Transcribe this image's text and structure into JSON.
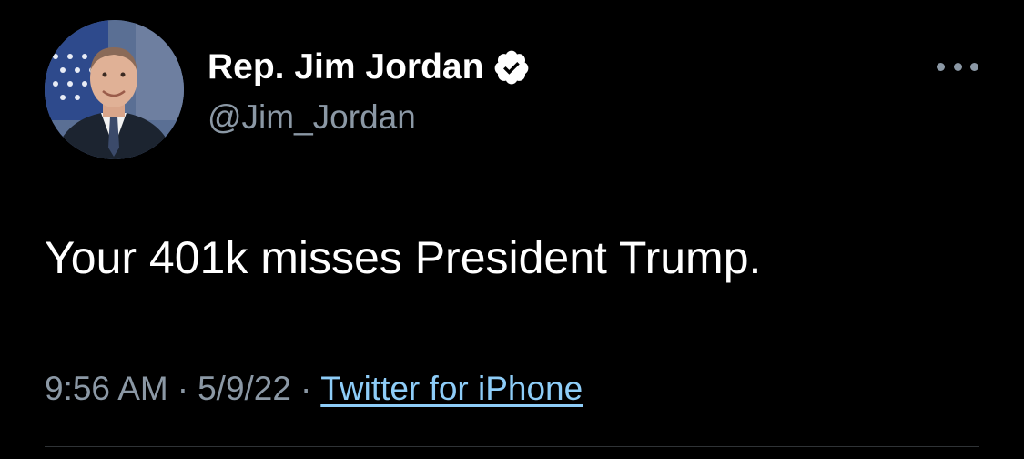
{
  "colors": {
    "background": "#000000",
    "primary_text": "#ffffff",
    "secondary_text": "#8b98a5",
    "link": "#8ecdf8",
    "verified_badge_fill": "#ffffff",
    "verified_check": "#000000"
  },
  "author": {
    "display_name": "Rep. Jim Jordan",
    "handle": "@Jim_Jordan",
    "verified": true,
    "verified_icon": "verified-badge-icon",
    "avatar_icon": "profile-photo"
  },
  "more_menu": {
    "icon": "more-options-icon"
  },
  "tweet": {
    "text": "Your 401k misses President Trump."
  },
  "meta": {
    "time": "9:56 AM",
    "separator": "·",
    "date": "5/9/22",
    "source": "Twitter for iPhone"
  }
}
